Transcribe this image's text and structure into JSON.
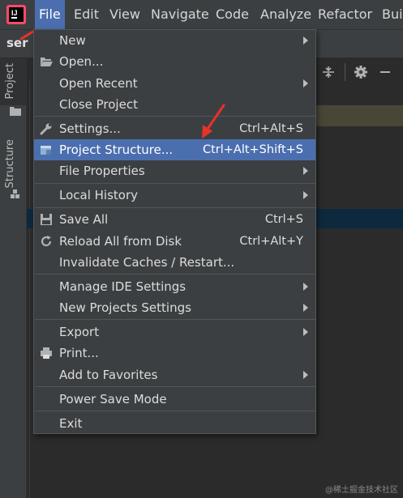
{
  "menubar": {
    "items": [
      {
        "label": "File",
        "active": true
      },
      {
        "label": "Edit"
      },
      {
        "label": "View"
      },
      {
        "label": "Navigate"
      },
      {
        "label": "Code"
      },
      {
        "label": "Analyze"
      },
      {
        "label": "Refactor"
      },
      {
        "label": "Buil"
      }
    ]
  },
  "project_tab": {
    "label_fragment": "ser"
  },
  "left_strip": {
    "tabs": [
      {
        "label": "Project"
      },
      {
        "label": "Structure"
      }
    ]
  },
  "file_menu": {
    "items": [
      {
        "label": "New",
        "submenu": true
      },
      {
        "label": "Open...",
        "icon": "folder-open-icon"
      },
      {
        "label": "Open Recent",
        "submenu": true
      },
      {
        "label": "Close Project"
      },
      {
        "label": "Settings...",
        "shortcut": "Ctrl+Alt+S",
        "icon": "wrench-icon"
      },
      {
        "label": "Project Structure...",
        "shortcut": "Ctrl+Alt+Shift+S",
        "icon": "project-structure-icon",
        "selected": true
      },
      {
        "label": "File Properties",
        "submenu": true
      },
      {
        "label": "Local History",
        "submenu": true
      },
      {
        "label": "Save All",
        "shortcut": "Ctrl+S",
        "icon": "save-icon"
      },
      {
        "label": "Reload All from Disk",
        "shortcut": "Ctrl+Alt+Y",
        "icon": "reload-icon"
      },
      {
        "label": "Invalidate Caches / Restart..."
      },
      {
        "label": "Manage IDE Settings",
        "submenu": true
      },
      {
        "label": "New Projects Settings",
        "submenu": true
      },
      {
        "label": "Export",
        "submenu": true
      },
      {
        "label": "Print...",
        "icon": "print-icon"
      },
      {
        "label": "Add to Favorites",
        "submenu": true
      },
      {
        "label": "Power Save Mode"
      },
      {
        "label": "Exit"
      }
    ]
  },
  "watermark": {
    "text": "@稀土掘金技术社区"
  },
  "colors": {
    "menu_bg": "#3c3f41",
    "selection": "#4b6eaf",
    "annotation_red": "#e8322a"
  }
}
